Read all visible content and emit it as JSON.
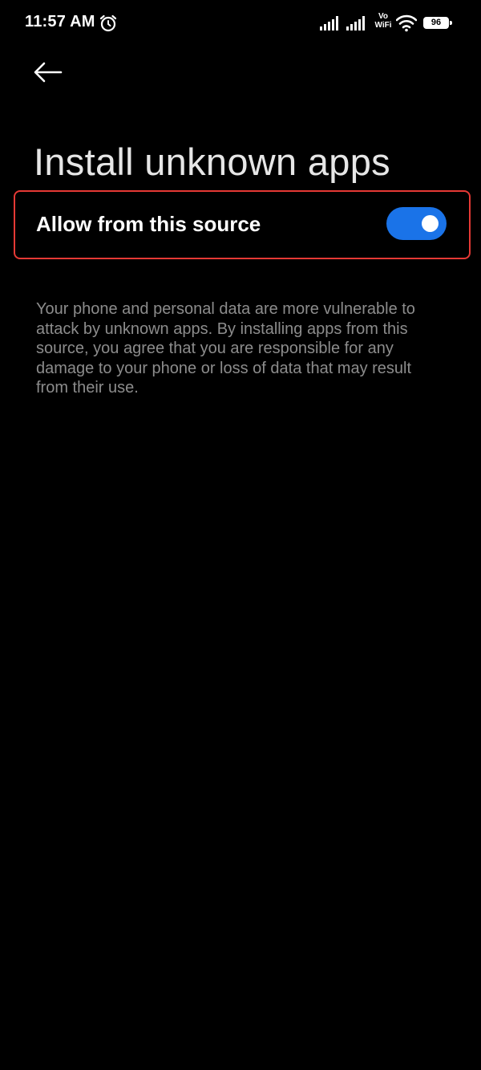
{
  "status_bar": {
    "time": "11:57 AM",
    "alarm_icon": "alarm-clock-icon",
    "signal_icons": [
      "cellular-signal-icon",
      "cellular-signal-icon"
    ],
    "vowifi_label_top": "Vo",
    "vowifi_label_bottom": "WiFi",
    "wifi_icon": "wifi-icon",
    "battery_level": "96"
  },
  "header": {
    "back_icon": "arrow-left-icon",
    "title": "Install unknown apps"
  },
  "setting": {
    "label": "Allow from this source",
    "toggle_on": true
  },
  "warning": {
    "text": "Your phone and personal data are more vulnerable to attack by unknown apps. By installing apps from this source, you agree that you are responsible for any damage to your phone or loss of data that may result from their use."
  },
  "colors": {
    "background": "#000000",
    "toggle_accent": "#1a73e8",
    "highlight_border": "#e53935",
    "secondary_text": "#8c8c8c"
  }
}
